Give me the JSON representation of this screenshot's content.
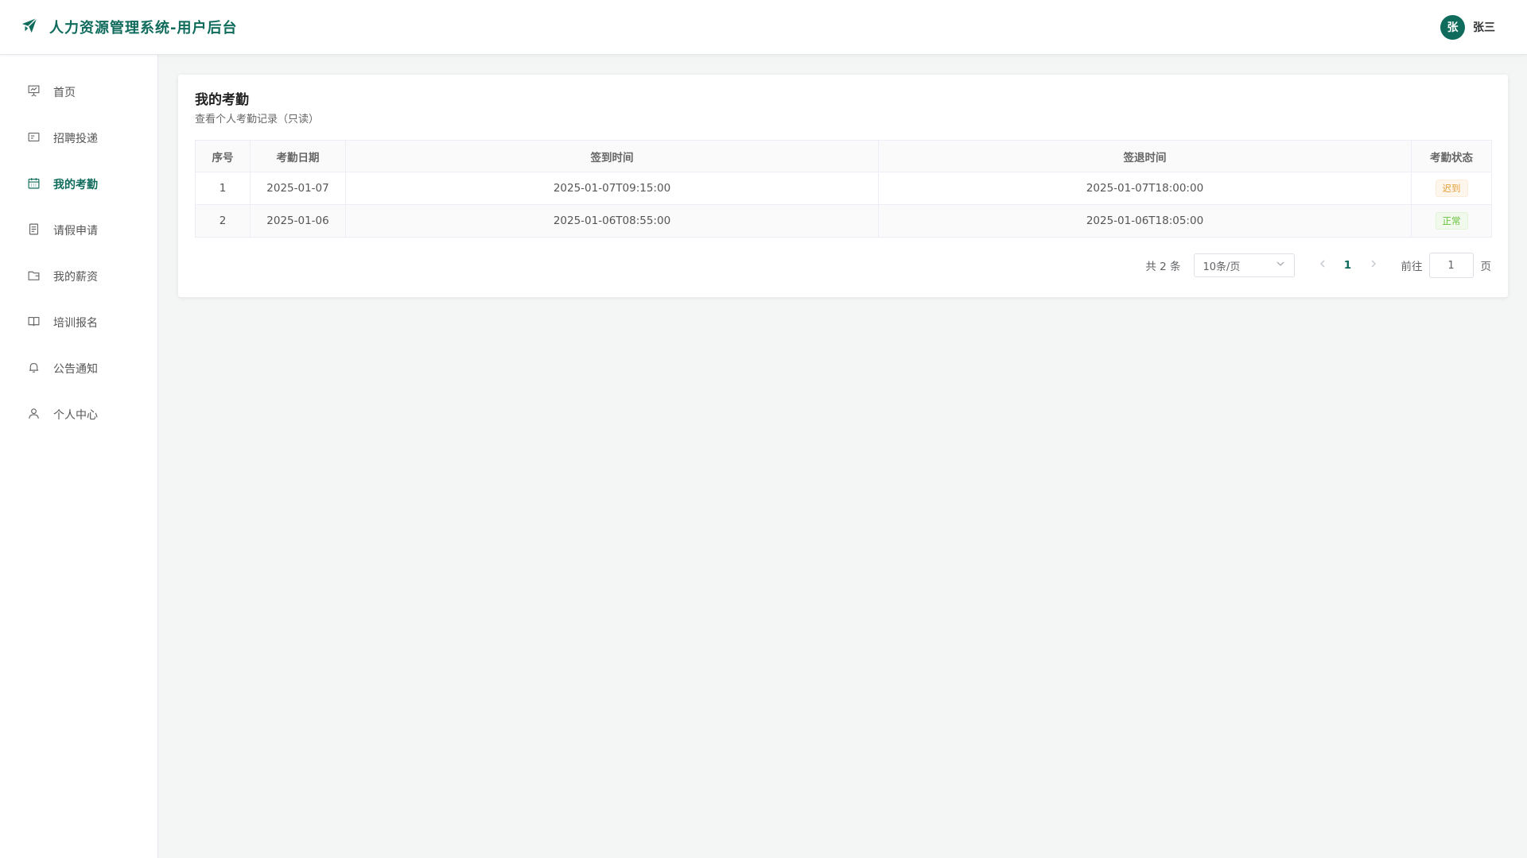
{
  "app": {
    "title": "人力资源管理系统-用户后台",
    "brand_color": "#0f6b5b",
    "logo_icon": "paper-plane-icon"
  },
  "user": {
    "avatar_text": "张",
    "name": "张三"
  },
  "sidebar": {
    "items": [
      {
        "label": "首页",
        "icon": "presentation-icon",
        "active": false
      },
      {
        "label": "招聘投递",
        "icon": "id-card-icon",
        "active": false
      },
      {
        "label": "我的考勤",
        "icon": "calendar-icon",
        "active": true
      },
      {
        "label": "请假申请",
        "icon": "document-icon",
        "active": false
      },
      {
        "label": "我的薪资",
        "icon": "wallet-icon",
        "active": false
      },
      {
        "label": "培训报名",
        "icon": "book-icon",
        "active": false
      },
      {
        "label": "公告通知",
        "icon": "bell-icon",
        "active": false
      },
      {
        "label": "个人中心",
        "icon": "user-icon",
        "active": false
      }
    ]
  },
  "page": {
    "title": "我的考勤",
    "subtitle": "查看个人考勤记录（只读）"
  },
  "table": {
    "headers": [
      "序号",
      "考勤日期",
      "签到时间",
      "签退时间",
      "考勤状态"
    ],
    "rows": [
      {
        "index": "1",
        "date": "2025-01-07",
        "sign_in": "2025-01-07T09:15:00",
        "sign_out": "2025-01-07T18:00:00",
        "status": "迟到"
      },
      {
        "index": "2",
        "date": "2025-01-06",
        "sign_in": "2025-01-06T08:55:00",
        "sign_out": "2025-01-06T18:05:00",
        "status": "正常"
      }
    ]
  },
  "pagination": {
    "total_text": "共 2 条",
    "page_size": "10条/页",
    "current_page": "1",
    "goto_label": "前往",
    "goto_value": "1",
    "page_unit": "页"
  }
}
